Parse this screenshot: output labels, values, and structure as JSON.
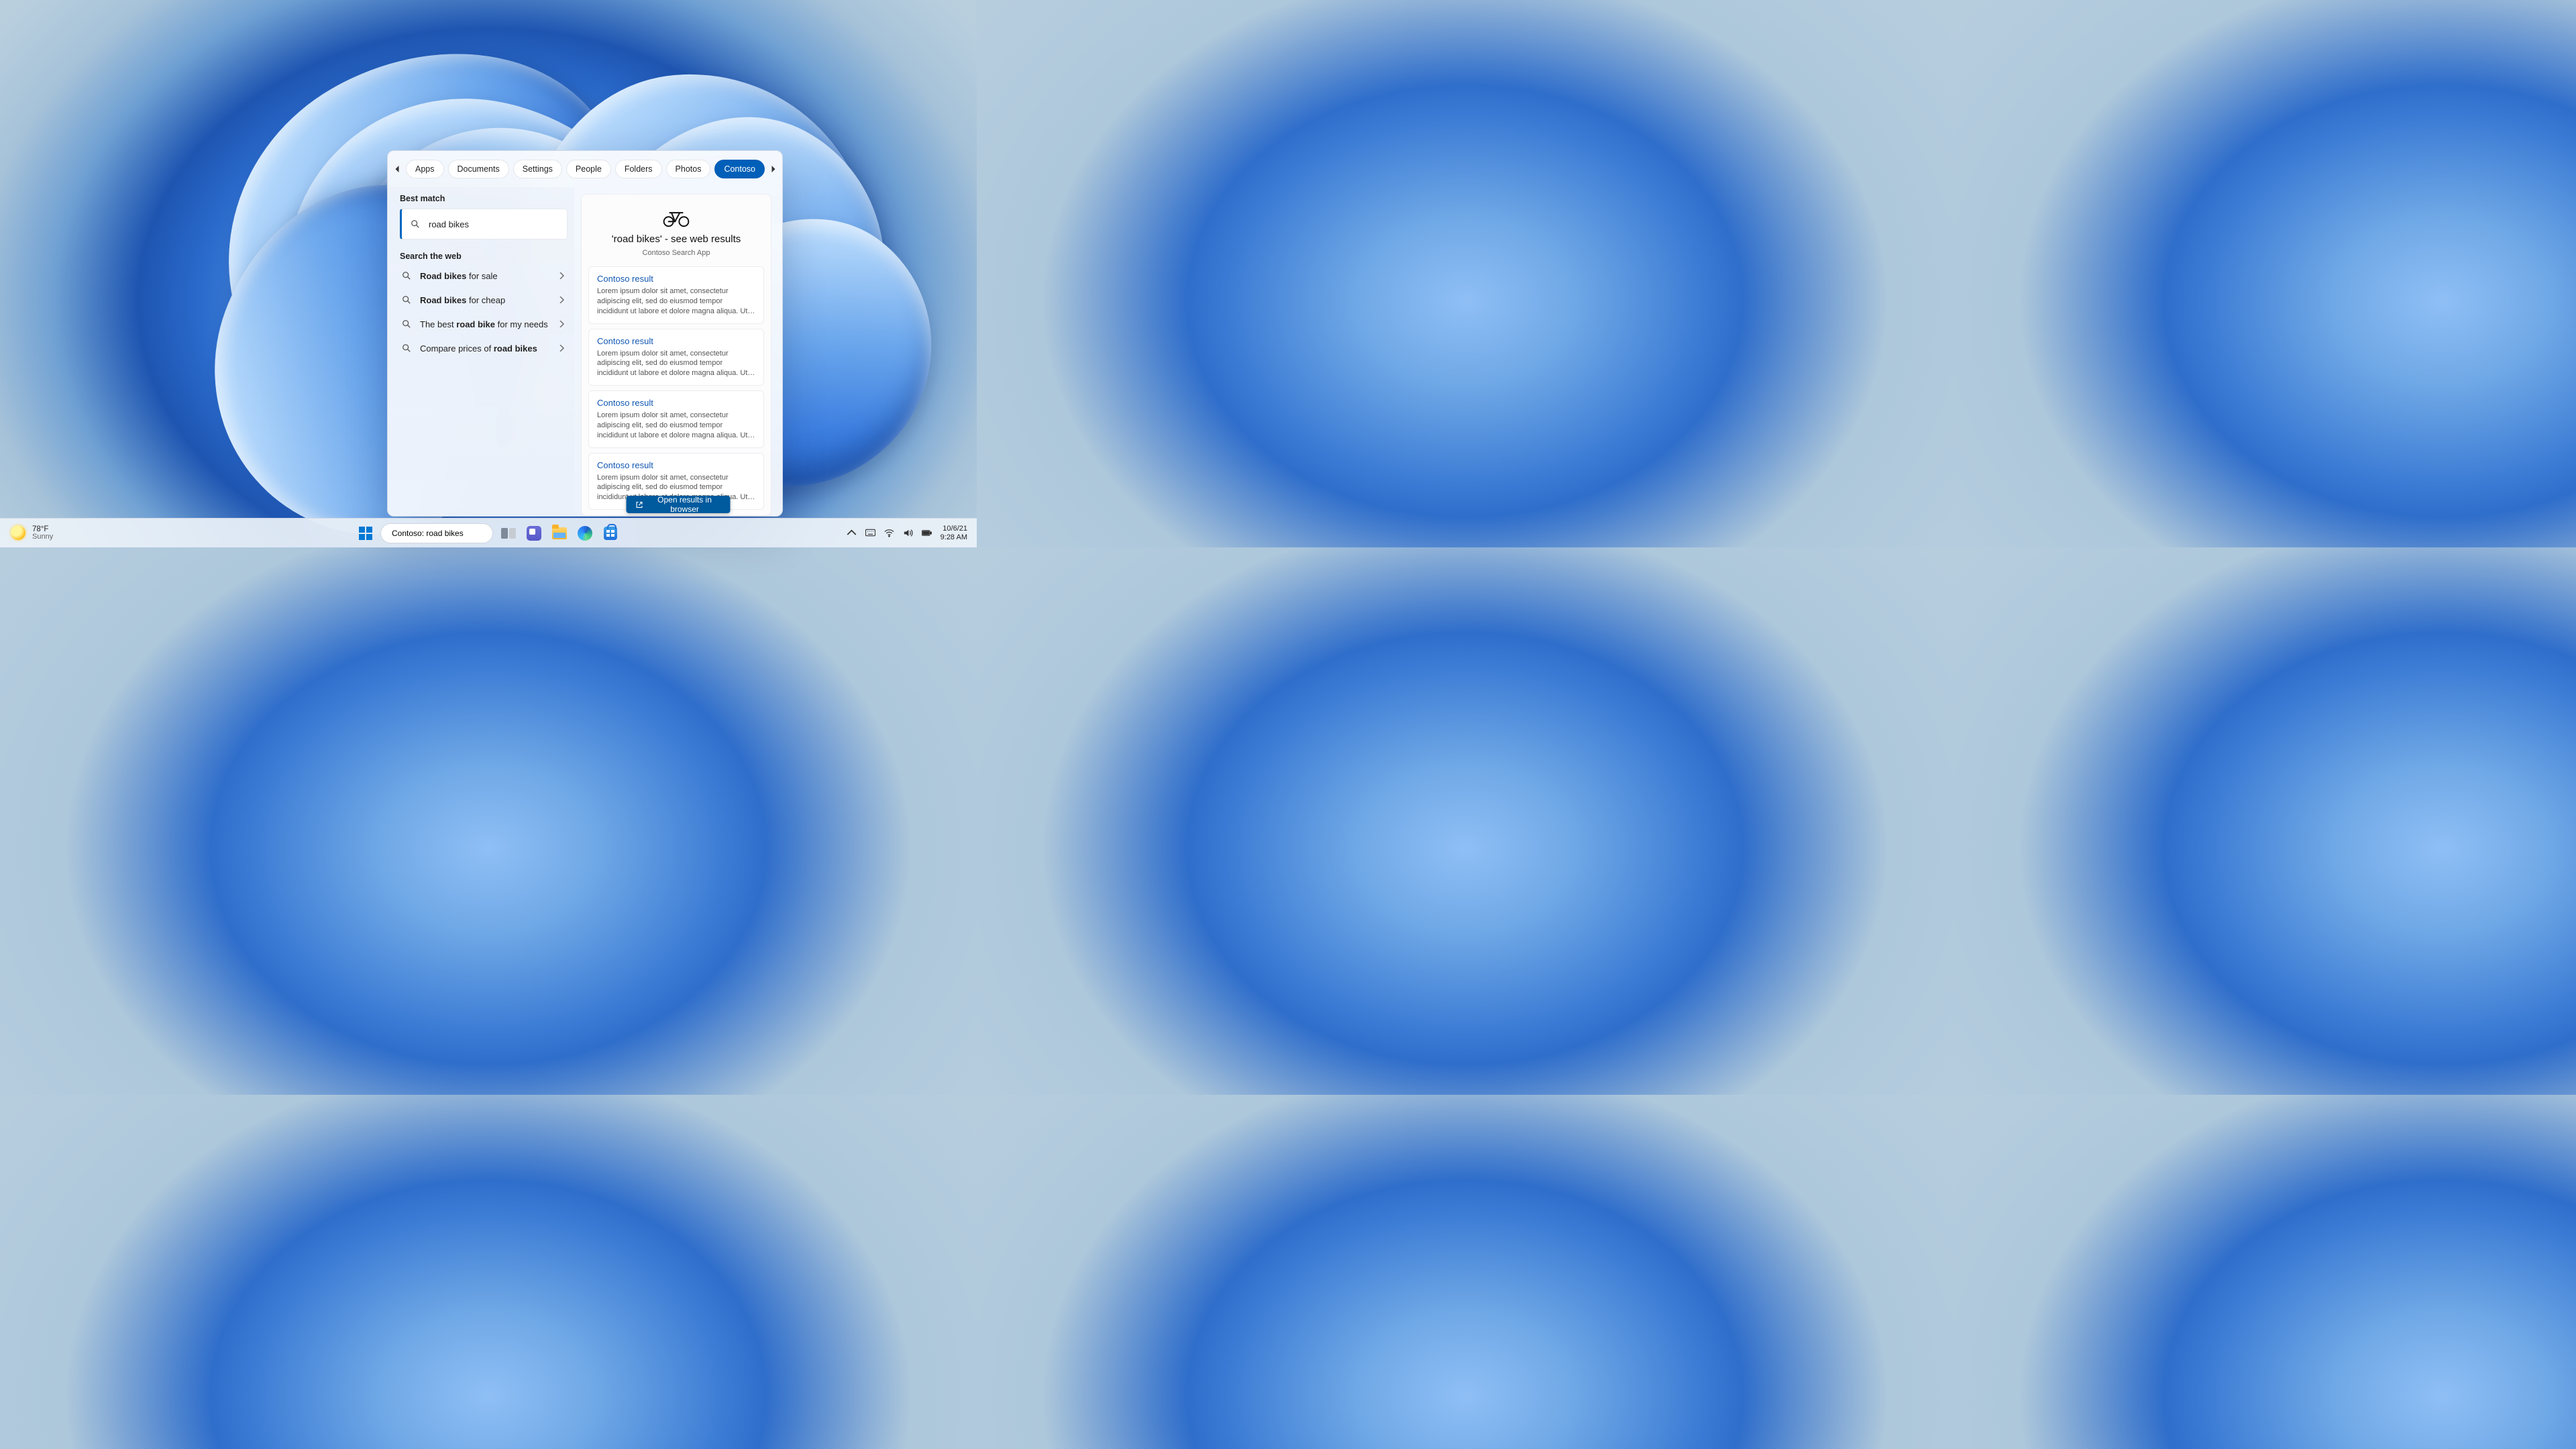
{
  "search_panel": {
    "tabs": [
      {
        "label": "Apps",
        "active": false
      },
      {
        "label": "Documents",
        "active": false
      },
      {
        "label": "Settings",
        "active": false
      },
      {
        "label": "People",
        "active": false
      },
      {
        "label": "Folders",
        "active": false
      },
      {
        "label": "Photos",
        "active": false
      },
      {
        "label": "Contoso",
        "active": true
      }
    ],
    "best_match_label": "Best match",
    "best_match_item": "road bikes",
    "search_web_label": "Search the web",
    "suggestions": [
      {
        "bold": "Road bikes",
        "rest": " for sale"
      },
      {
        "bold": "Road bikes",
        "rest": " for cheap"
      },
      {
        "pre": "The best ",
        "bold": "road bike",
        "rest": " for my needs"
      },
      {
        "pre": "Compare prices of ",
        "bold": "road bikes",
        "rest": ""
      }
    ],
    "preview": {
      "title": "'road bikes' - see web results",
      "subtitle": "Contoso Search App",
      "open_button": "Open results in browser",
      "results": [
        {
          "title": "Contoso result",
          "body": "Lorem ipsum dolor sit amet, consectetur adipiscing elit, sed do eiusmod tempor incididunt ut labore et dolore magna aliqua. Ut enim ad minim veniam, quis nostrud exercitation ullamco…"
        },
        {
          "title": "Contoso result",
          "body": "Lorem ipsum dolor sit amet, consectetur adipiscing elit, sed do eiusmod tempor incididunt ut labore et dolore magna aliqua. Ut enim ad minim veniam, quis nostrud exercitation ullamco…"
        },
        {
          "title": "Contoso result",
          "body": "Lorem ipsum dolor sit amet, consectetur adipiscing elit, sed do eiusmod tempor incididunt ut labore et dolore magna aliqua. Ut enim ad minim veniam, quis nostrud exercitation ullamco…"
        },
        {
          "title": "Contoso result",
          "body": "Lorem ipsum dolor sit amet, consectetur adipiscing elit, sed do eiusmod tempor incididunt ut labore et dolore magna aliqua. Ut enim ad minim veniam, quis nostrud exercitation ullamco…"
        }
      ]
    }
  },
  "taskbar": {
    "weather_temp": "78°F",
    "weather_cond": "Sunny",
    "search_value": "Contoso: road bikes",
    "date": "10/6/21",
    "time": "9:28 AM"
  }
}
